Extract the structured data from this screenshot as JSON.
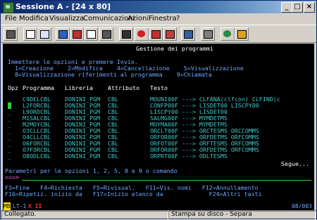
{
  "window": {
    "title": "Sessione A - [24 x 80]"
  },
  "menu": [
    "File",
    "Modifica",
    "Visualizza",
    "Comunicazioni",
    "Azioni",
    "Finestra",
    "?"
  ],
  "toolbar_icons": [
    "print-icon",
    "copy-icon",
    "paste-icon",
    "send-icon",
    "receive-icon",
    "display-icon",
    "macro-icon",
    "record-icon",
    "stop-icon",
    "play-icon",
    "script-icon",
    "customize-icon",
    "color-icon",
    "help-icon"
  ],
  "screen": {
    "title": "Gestione dei programmi",
    "instructions": "Immettere le opzioni e premere Invio.",
    "options_line1": "1=Creazione    2=Modifica    4=Cancellazione    5=Visualizzazione",
    "options_line2": "8=Visualizzazione riferimenti al programma    9=Chiamata",
    "headers": {
      "opz": "Opz",
      "programma": "Programma",
      "libreria": "Libreria",
      "attributo": "Attributo",
      "testo": "Testo"
    },
    "rows": [
      {
        "opz": "_",
        "programma": "C9DELCBL",
        "libreria": "DONINI_PGM",
        "attributo": "CBL",
        "testo": "MOUNI00F ---> CLFANA(clfcon) CLFIND(c"
      },
      {
        "opz": "_",
        "programma": "L2FORCBL",
        "libreria": "DONINI_PGM",
        "attributo": "CBL",
        "testo": "CONFP00F ---> LISDET00 LISCPY00"
      },
      {
        "opz": "_",
        "programma": "L9ORDCBL",
        "libreria": "DONINI_PGM",
        "attributo": "CBL",
        "testo": "LISCPY00 ---> LISDET00"
      },
      {
        "opz": "_",
        "programma": "M1SALCBL",
        "libreria": "DONINI_PGM",
        "attributo": "CBL",
        "testo": "SALMG00F ---> MYMDETMS"
      },
      {
        "opz": "_",
        "programma": "M2MOYCBL",
        "libreria": "DONINI_PGM",
        "attributo": "CBL",
        "testo": "MOYMA00F ---> MYMDETMS"
      },
      {
        "opz": "_",
        "programma": "O3CLLCBL",
        "libreria": "DONINI_PGM",
        "attributo": "CBL",
        "testo": "ORCLT00F ---> ORCTESMS ORCCOMMS"
      },
      {
        "opz": "_",
        "programma": "O4CLLCBL",
        "libreria": "DONINI_PGM",
        "attributo": "CBL",
        "testo": "ORFOR00F ---> ORFDETMS ORFCOMMS"
      },
      {
        "opz": "_",
        "programma": "O6FORCBL",
        "libreria": "DONINI_PGM",
        "attributo": "CBL",
        "testo": "ORFOT00F ---> ORFTESMS ORFCOMMS"
      },
      {
        "opz": "_",
        "programma": "O7FORCBL",
        "libreria": "DONINI_PGM",
        "attributo": "CBL",
        "testo": "ORFOR00F ---> ORFDETMS ORFCOMMS"
      },
      {
        "opz": "_",
        "programma": "O8ODLCBL",
        "libreria": "DONINI_PGM",
        "attributo": "CBL",
        "testo": "ORPRT00F ---> ODLTESMS"
      }
    ],
    "more": "Segue...",
    "param_label": "Parametri per le opzioni 1, 2, 5, 8 e 9 o comando",
    "prompt": "===>",
    "fkeys1": "F3=Fine   F4=Richiesta   F5=Rivisual.   F11=Vis. nomi   F12=Annullamento",
    "fkeys2": "F16=Ripetiz. inizio da   F17=Inizio elenco da             F24=Altri tasti"
  },
  "oia": {
    "left": "MB",
    "session": "LT-1",
    "error": "X II",
    "position": "08/003"
  },
  "statusbar": {
    "left": "Collegato.",
    "right": "Stampa su disco - Separa"
  }
}
